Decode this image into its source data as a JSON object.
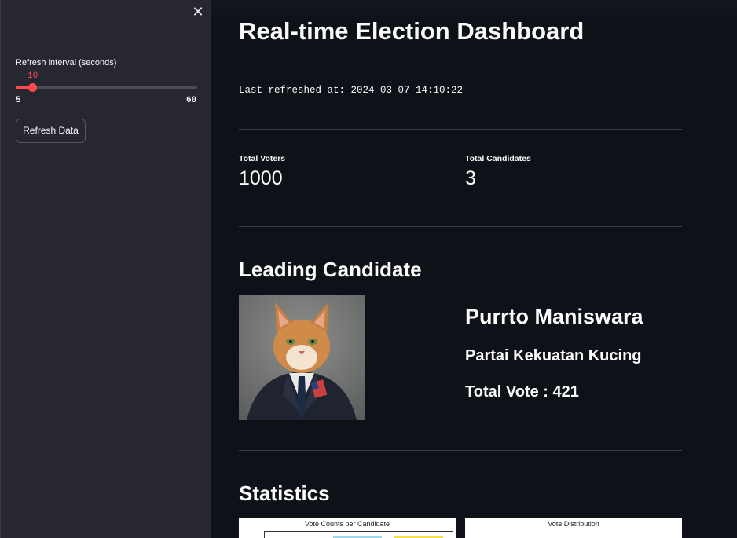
{
  "sidebar": {
    "close_icon": "close-icon",
    "slider": {
      "label": "Refresh interval (seconds)",
      "value": "10",
      "min": "5",
      "max": "60",
      "fraction": 0.0909,
      "accent": "#ff4b4b"
    },
    "refresh_button": "Refresh Data"
  },
  "main": {
    "title": "Real-time Election Dashboard",
    "last_refreshed": "Last refreshed at: 2024-03-07 14:10:22",
    "metrics": [
      {
        "label": "Total Voters",
        "value": "1000"
      },
      {
        "label": "Total Candidates",
        "value": "3"
      }
    ],
    "leading": {
      "heading": "Leading Candidate",
      "name": "Purrto Maniswara",
      "party": "Partai Kekuatan Kucing",
      "total_vote": "Total Vote : 421"
    },
    "statistics": {
      "heading": "Statistics",
      "chart1_title": "Vote Counts per Candidate",
      "chart2_title": "Vote Distribution"
    }
  },
  "colors": {
    "background": "#0e1117",
    "sidebar": "#262730",
    "accent": "#ff4b4b"
  }
}
